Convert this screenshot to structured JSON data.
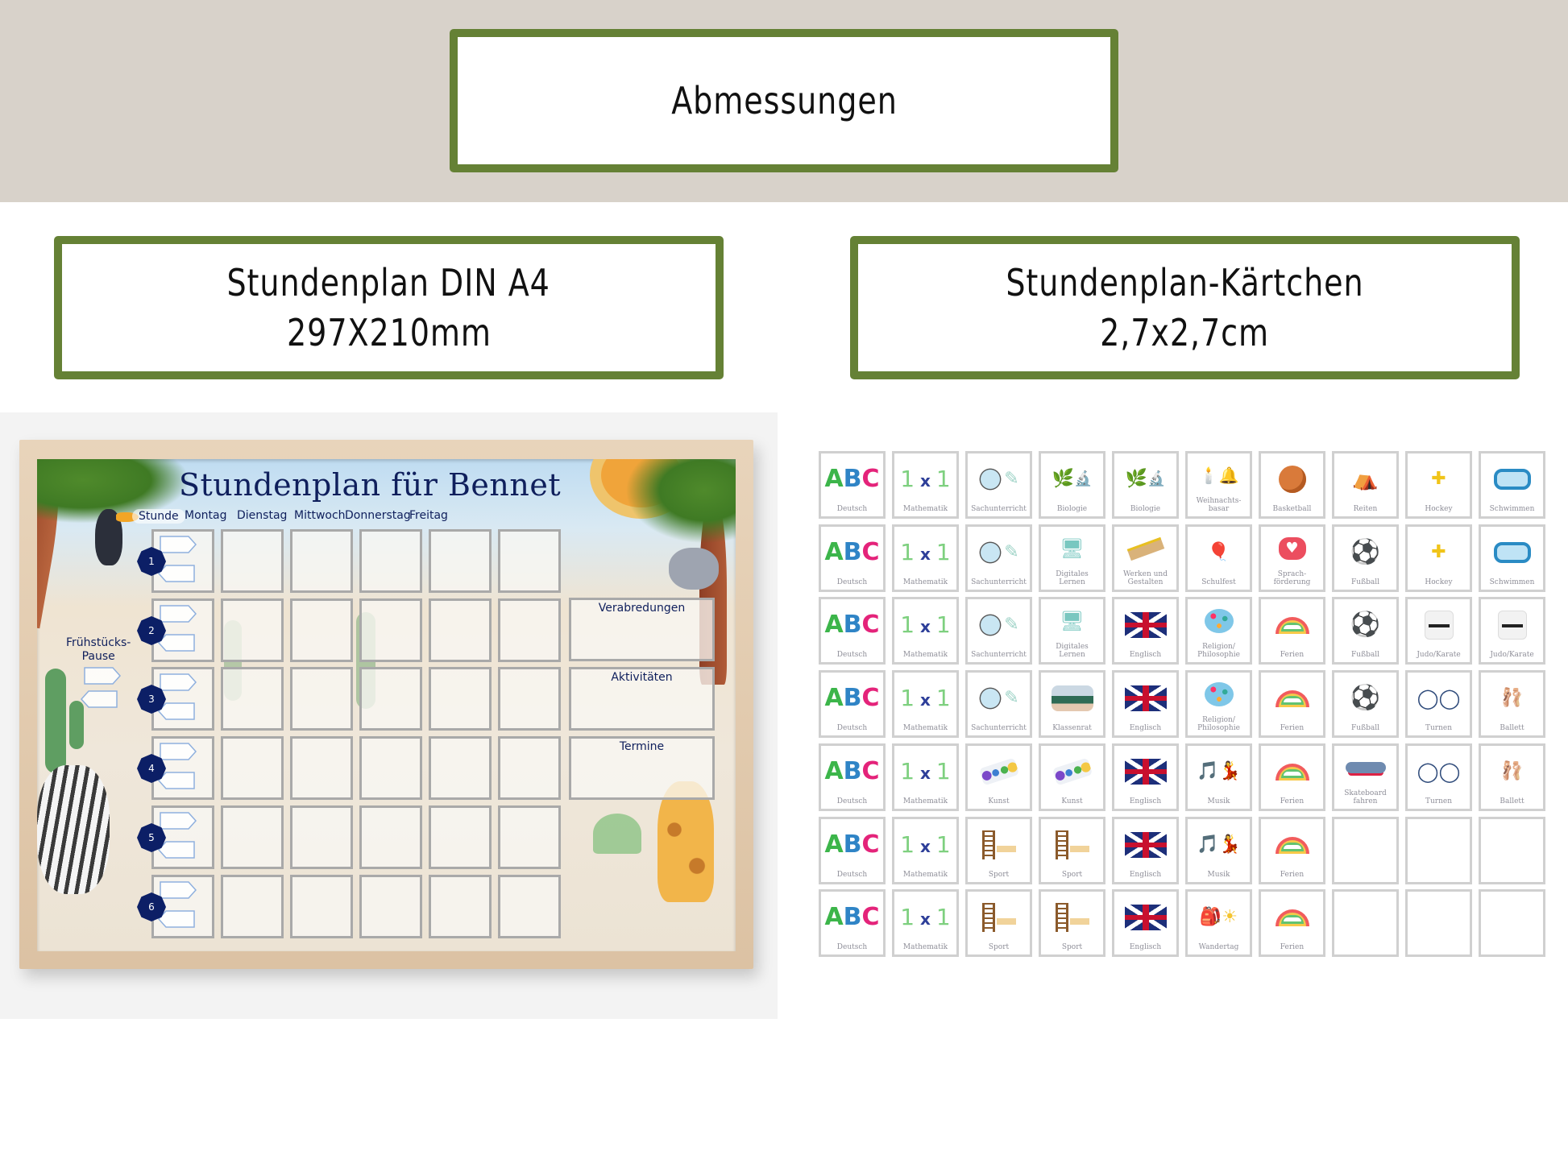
{
  "header": {
    "title": "Abmessungen"
  },
  "sections": {
    "left": {
      "line1": "Stundenplan DIN A4",
      "line2": "297X210mm"
    },
    "right": {
      "line1": "Stundenplan-Kärtchen",
      "line2": "2,7x2,7cm"
    }
  },
  "colors": {
    "accent_green": "#658135",
    "band": "#d8d2ca",
    "navy": "#0f1f5c",
    "card_border": "#d0d0d0",
    "card_label": "#8e8e98"
  },
  "poster": {
    "title": "Stundenplan für Bennet",
    "columns": [
      "Stunde",
      "Montag",
      "Dienstag",
      "Mittwoch",
      "Donnerstag",
      "Freitag"
    ],
    "periods": [
      "1",
      "2",
      "3",
      "4",
      "5",
      "6"
    ],
    "pause_label": "Frühstücks-\nPause",
    "side_boxes": [
      "Verabredungen",
      "Aktivitäten",
      "Termine"
    ]
  },
  "cards": {
    "rows": [
      [
        {
          "icon": "abc",
          "label": "Deutsch"
        },
        {
          "icon": "1x1",
          "label": "Mathematik"
        },
        {
          "icon": "microscope-petri",
          "label": "Sachunterricht"
        },
        {
          "icon": "biology-plants",
          "label": "Biologie"
        },
        {
          "icon": "biology-plants",
          "label": "Biologie"
        },
        {
          "icon": "candles-bells",
          "label": "Weihnachts-\nbasar"
        },
        {
          "icon": "basketball",
          "label": "Basketball"
        },
        {
          "icon": "saddle",
          "label": "Reiten"
        },
        {
          "icon": "hockey",
          "label": "Hockey"
        },
        {
          "icon": "snorkel",
          "label": "Schwimmen"
        }
      ],
      [
        {
          "icon": "abc",
          "label": "Deutsch"
        },
        {
          "icon": "1x1",
          "label": "Mathematik"
        },
        {
          "icon": "microscope-petri",
          "label": "Sachunterricht"
        },
        {
          "icon": "computer",
          "label": "Digitales\nLernen"
        },
        {
          "icon": "saw",
          "label": "Werken und\nGestalten"
        },
        {
          "icon": "kids-balloons",
          "label": "Schulfest"
        },
        {
          "icon": "heart-bubble",
          "label": "Sprach-\nförderung"
        },
        {
          "icon": "soccer-ball",
          "label": "Fußball"
        },
        {
          "icon": "hockey",
          "label": "Hockey"
        },
        {
          "icon": "snorkel",
          "label": "Schwimmen"
        }
      ],
      [
        {
          "icon": "abc",
          "label": "Deutsch"
        },
        {
          "icon": "1x1",
          "label": "Mathematik"
        },
        {
          "icon": "microscope-petri",
          "label": "Sachunterricht"
        },
        {
          "icon": "computer",
          "label": "Digitales\nLernen"
        },
        {
          "icon": "uk-flag",
          "label": "Englisch"
        },
        {
          "icon": "religion-symbols",
          "label": "Religion/\nPhilosophie"
        },
        {
          "icon": "rainbow-bunting",
          "label": "Ferien"
        },
        {
          "icon": "soccer-ball",
          "label": "Fußball"
        },
        {
          "icon": "judo-gi",
          "label": "Judo/Karate"
        },
        {
          "icon": "judo-gi",
          "label": "Judo/Karate"
        }
      ],
      [
        {
          "icon": "abc",
          "label": "Deutsch"
        },
        {
          "icon": "1x1",
          "label": "Mathematik"
        },
        {
          "icon": "microscope-petri",
          "label": "Sachunterricht"
        },
        {
          "icon": "classroom",
          "label": "Klassenrat"
        },
        {
          "icon": "uk-flag",
          "label": "Englisch"
        },
        {
          "icon": "religion-symbols",
          "label": "Religion/\nPhilosophie"
        },
        {
          "icon": "rainbow-bunting",
          "label": "Ferien"
        },
        {
          "icon": "soccer-ball",
          "label": "Fußball"
        },
        {
          "icon": "gym-rings",
          "label": "Turnen"
        },
        {
          "icon": "ballet-shoes",
          "label": "Ballett"
        }
      ],
      [
        {
          "icon": "abc",
          "label": "Deutsch"
        },
        {
          "icon": "1x1",
          "label": "Mathematik"
        },
        {
          "icon": "paint-palette",
          "label": "Kunst"
        },
        {
          "icon": "paint-palette",
          "label": "Kunst"
        },
        {
          "icon": "uk-flag",
          "label": "Englisch"
        },
        {
          "icon": "music-dancers",
          "label": "Musik"
        },
        {
          "icon": "rainbow-bunting",
          "label": "Ferien"
        },
        {
          "icon": "skateboard",
          "label": "Skateboard\nfahren"
        },
        {
          "icon": "gym-rings",
          "label": "Turnen"
        },
        {
          "icon": "ballet-shoes",
          "label": "Ballett"
        }
      ],
      [
        {
          "icon": "abc",
          "label": "Deutsch"
        },
        {
          "icon": "1x1",
          "label": "Mathematik"
        },
        {
          "icon": "wall-bars",
          "label": "Sport"
        },
        {
          "icon": "wall-bars",
          "label": "Sport"
        },
        {
          "icon": "uk-flag",
          "label": "Englisch"
        },
        {
          "icon": "music-dancers",
          "label": "Musik"
        },
        {
          "icon": "rainbow-bunting",
          "label": "Ferien"
        },
        {
          "icon": "empty",
          "label": ""
        },
        {
          "icon": "empty",
          "label": ""
        },
        {
          "icon": "empty",
          "label": ""
        }
      ],
      [
        {
          "icon": "abc",
          "label": "Deutsch"
        },
        {
          "icon": "1x1",
          "label": "Mathematik"
        },
        {
          "icon": "wall-bars",
          "label": "Sport"
        },
        {
          "icon": "wall-bars",
          "label": "Sport"
        },
        {
          "icon": "uk-flag",
          "label": "Englisch"
        },
        {
          "icon": "backpack-sun",
          "label": "Wandertag"
        },
        {
          "icon": "rainbow-bunting",
          "label": "Ferien"
        },
        {
          "icon": "empty",
          "label": ""
        },
        {
          "icon": "empty",
          "label": ""
        },
        {
          "icon": "empty",
          "label": ""
        }
      ]
    ]
  }
}
